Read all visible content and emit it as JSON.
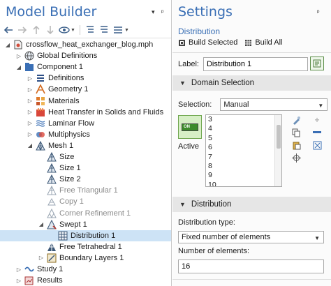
{
  "model_builder": {
    "title": "Model Builder",
    "title_controls": [
      "▾",
      "ᵖ"
    ],
    "toolbar_icons": [
      "back-arrow-icon",
      "forward-arrow-icon",
      "up-arrow-icon",
      "down-arrow-icon",
      "eye-icon",
      "expand-all-icon",
      "collapse-all-icon",
      "list-view-icon"
    ],
    "tree": [
      {
        "label": "crossflow_heat_exchanger_blog.mph",
        "icon": "model-file-icon",
        "depth": 0,
        "expanded": true,
        "dim": false
      },
      {
        "label": "Global Definitions",
        "icon": "globe-icon",
        "depth": 1,
        "expanded": false,
        "dim": false
      },
      {
        "label": "Component 1",
        "icon": "component-icon",
        "depth": 1,
        "expanded": true,
        "dim": false
      },
      {
        "label": "Definitions",
        "icon": "definitions-icon",
        "depth": 2,
        "expanded": false,
        "dim": false
      },
      {
        "label": "Geometry 1",
        "icon": "geometry-icon",
        "depth": 2,
        "expanded": false,
        "dim": false
      },
      {
        "label": "Materials",
        "icon": "materials-icon",
        "depth": 2,
        "expanded": false,
        "dim": false
      },
      {
        "label": "Heat Transfer in Solids and Fluids",
        "icon": "heat-transfer-icon",
        "depth": 2,
        "expanded": false,
        "dim": false
      },
      {
        "label": "Laminar Flow",
        "icon": "laminar-flow-icon",
        "depth": 2,
        "expanded": false,
        "dim": false
      },
      {
        "label": "Multiphysics",
        "icon": "multiphysics-icon",
        "depth": 2,
        "expanded": false,
        "dim": false
      },
      {
        "label": "Mesh 1",
        "icon": "mesh-icon",
        "depth": 2,
        "expanded": true,
        "dim": false
      },
      {
        "label": "Size",
        "icon": "size-icon",
        "depth": 3,
        "expanded": null,
        "dim": false
      },
      {
        "label": "Size 1",
        "icon": "size-icon",
        "depth": 3,
        "expanded": null,
        "dim": false
      },
      {
        "label": "Size 2",
        "icon": "size-icon",
        "depth": 3,
        "expanded": null,
        "dim": false
      },
      {
        "label": "Free Triangular 1",
        "icon": "free-triangular-icon",
        "depth": 3,
        "expanded": null,
        "dim": true
      },
      {
        "label": "Copy 1",
        "icon": "copy-icon",
        "depth": 3,
        "expanded": null,
        "dim": true
      },
      {
        "label": "Corner Refinement 1",
        "icon": "corner-refinement-icon",
        "depth": 3,
        "expanded": null,
        "dim": true
      },
      {
        "label": "Swept 1",
        "icon": "swept-icon",
        "depth": 3,
        "expanded": true,
        "dim": false
      },
      {
        "label": "Distribution 1",
        "icon": "distribution-icon",
        "depth": 4,
        "expanded": null,
        "dim": false,
        "selected": true
      },
      {
        "label": "Free Tetrahedral 1",
        "icon": "free-tetrahedral-icon",
        "depth": 3,
        "expanded": null,
        "dim": false
      },
      {
        "label": "Boundary Layers 1",
        "icon": "boundary-layers-icon",
        "depth": 3,
        "expanded": false,
        "dim": false
      },
      {
        "label": "Study 1",
        "icon": "study-icon",
        "depth": 1,
        "expanded": false,
        "dim": false
      },
      {
        "label": "Results",
        "icon": "results-icon",
        "depth": 1,
        "expanded": false,
        "dim": false
      }
    ]
  },
  "settings": {
    "title": "Settings",
    "subtitle": "Distribution",
    "build_selected": "Build Selected",
    "build_all": "Build All",
    "label_caption": "Label:",
    "label_value": "Distribution 1",
    "domain_section": "Domain Selection",
    "selection_caption": "Selection:",
    "selection_value": "Manual",
    "active_toggle": "ON",
    "active_label": "Active",
    "domain_list": [
      "3",
      "4",
      "5",
      "6",
      "7",
      "8",
      "9",
      "10"
    ],
    "distribution_section": "Distribution",
    "dist_type_caption": "Distribution type:",
    "dist_type_value": "Fixed number of elements",
    "num_elements_caption": "Number of elements:",
    "num_elements_value": "16",
    "colors": {
      "accent_blue": "#3a6fb5",
      "selected_row": "#cde3f6",
      "active_green": "#3d8b2c"
    }
  }
}
